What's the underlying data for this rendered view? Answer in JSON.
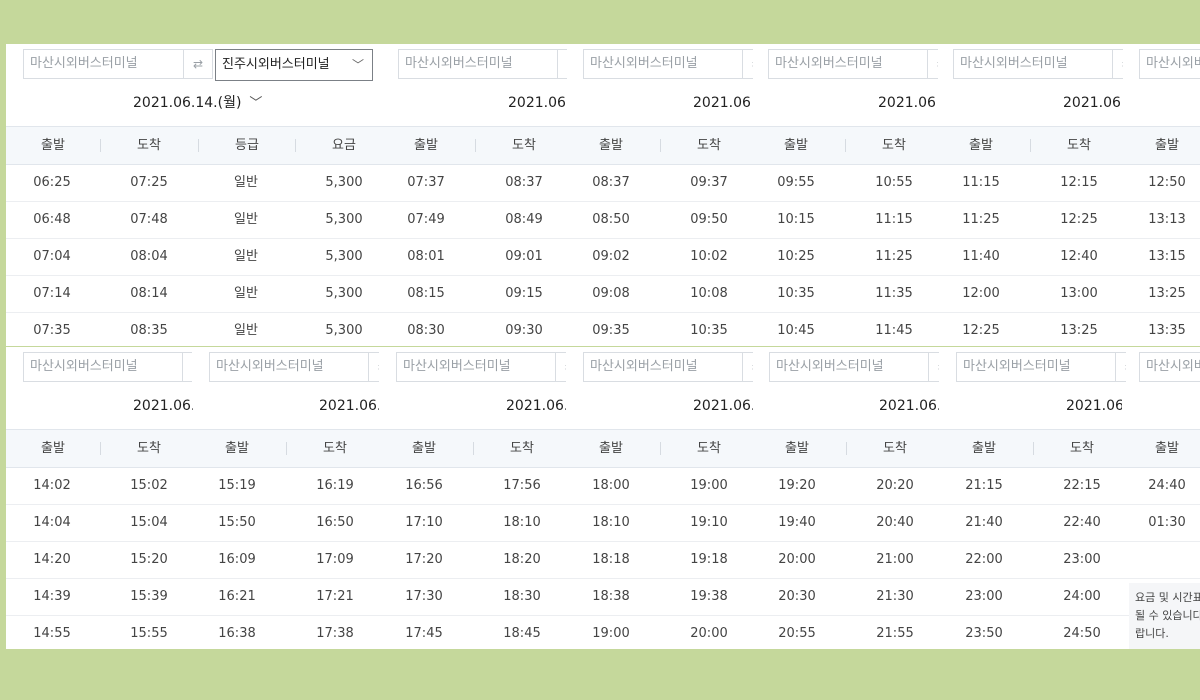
{
  "origin_placeholder": "마산시외버스터미널",
  "swap_icon": "swap-arrows-icon",
  "destination": "진주시외버스터미널",
  "full_date": "2021.06.14.(월)",
  "partial_date": "2021.06.",
  "partial_date_cut": "2021.06",
  "headers": {
    "departure": "출발",
    "arrival": "도착",
    "grade": "등급",
    "fare": "요금"
  },
  "top_rows": [
    [
      "06:25",
      "07:25",
      "일반",
      "5,300",
      "07:37",
      "08:37",
      "08:37",
      "09:37",
      "09:55",
      "10:55",
      "11:15",
      "12:15",
      "12:50"
    ],
    [
      "06:48",
      "07:48",
      "일반",
      "5,300",
      "07:49",
      "08:49",
      "08:50",
      "09:50",
      "10:15",
      "11:15",
      "11:25",
      "12:25",
      "13:13"
    ],
    [
      "07:04",
      "08:04",
      "일반",
      "5,300",
      "08:01",
      "09:01",
      "09:02",
      "10:02",
      "10:25",
      "11:25",
      "11:40",
      "12:40",
      "13:15"
    ],
    [
      "07:14",
      "08:14",
      "일반",
      "5,300",
      "08:15",
      "09:15",
      "09:08",
      "10:08",
      "10:35",
      "11:35",
      "12:00",
      "13:00",
      "13:25"
    ],
    [
      "07:35",
      "08:35",
      "일반",
      "5,300",
      "08:30",
      "09:30",
      "09:35",
      "10:35",
      "10:45",
      "11:45",
      "12:25",
      "13:25",
      "13:35"
    ]
  ],
  "bottom_rows": [
    [
      "14:02",
      "15:02",
      "15:19",
      "16:19",
      "16:56",
      "17:56",
      "18:00",
      "19:00",
      "19:20",
      "20:20",
      "21:15",
      "22:15",
      "24:40"
    ],
    [
      "14:04",
      "15:04",
      "15:50",
      "16:50",
      "17:10",
      "18:10",
      "18:10",
      "19:10",
      "19:40",
      "20:40",
      "21:40",
      "22:40",
      "01:30"
    ],
    [
      "14:20",
      "15:20",
      "16:09",
      "17:09",
      "17:20",
      "18:20",
      "18:18",
      "19:18",
      "20:00",
      "21:00",
      "22:00",
      "23:00",
      ""
    ],
    [
      "14:39",
      "15:39",
      "16:21",
      "17:21",
      "17:30",
      "18:30",
      "18:38",
      "19:38",
      "20:30",
      "21:30",
      "23:00",
      "24:00",
      ""
    ],
    [
      "14:55",
      "15:55",
      "16:38",
      "17:38",
      "17:45",
      "18:45",
      "19:00",
      "20:00",
      "20:55",
      "21:55",
      "23:50",
      "24:50",
      ""
    ]
  ],
  "notice_lines": [
    "요금 및 시간표",
    "될 수 있습니다",
    "랍니다."
  ]
}
